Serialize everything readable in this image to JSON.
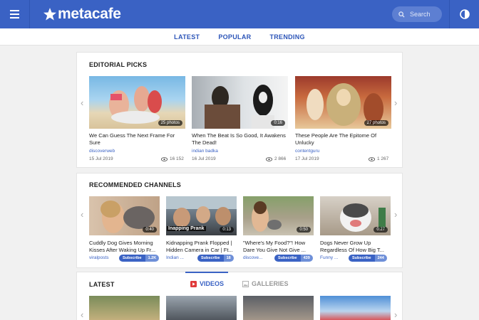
{
  "header": {
    "logo_text": "metacafe",
    "search_placeholder": "Search"
  },
  "subnav": [
    "LATEST",
    "POPULAR",
    "TRENDING"
  ],
  "editorial": {
    "title": "EDITORIAL PICKS",
    "cards": [
      {
        "badge": "25 photos",
        "title": "We Can Guess The Next Frame For Sure",
        "source": "discoverweb",
        "date": "15 Jul 2019",
        "views": "16 152"
      },
      {
        "badge": "0:16",
        "title": "When The Beat Is So Good, It Awakens The Dead!",
        "source": "indian badka",
        "date": "16 Jul 2019",
        "views": "2 866"
      },
      {
        "badge": "27 photos",
        "title": "These People Are The Epitome Of Unlucky",
        "source": "contentguru",
        "date": "17 Jul 2019",
        "views": "1 267"
      }
    ]
  },
  "channels": {
    "title": "RECOMMENDED CHANNELS",
    "subscribe_label": "Subscribe",
    "cards": [
      {
        "badge": "0:40",
        "title": "Cuddly Dog Gives Morning Kisses After Waking Up Fr...",
        "source": "viralposts",
        "count": "1.2K"
      },
      {
        "badge": "0:13",
        "title": "Kidnapping Prank Flopped | Hidden Camera in Car | Ft...",
        "source": "Indian ...",
        "count": "18",
        "overlay": "Inapping Prank"
      },
      {
        "badge": "0:50",
        "title": "\"Where's My Food?\"! How Dare You Give Not Give ...",
        "source": "discove...",
        "count": "439"
      },
      {
        "badge": "0:27",
        "title": "Dogs Never Grow Up Regardless Of How Big T...",
        "source": "Funny ...",
        "count": "244"
      }
    ]
  },
  "latest": {
    "title": "LATEST",
    "tab_videos": "VIDEOS",
    "tab_galleries": "GALLERIES"
  },
  "colors": {
    "brand": "#3a62c4",
    "link": "#2c55b8"
  }
}
